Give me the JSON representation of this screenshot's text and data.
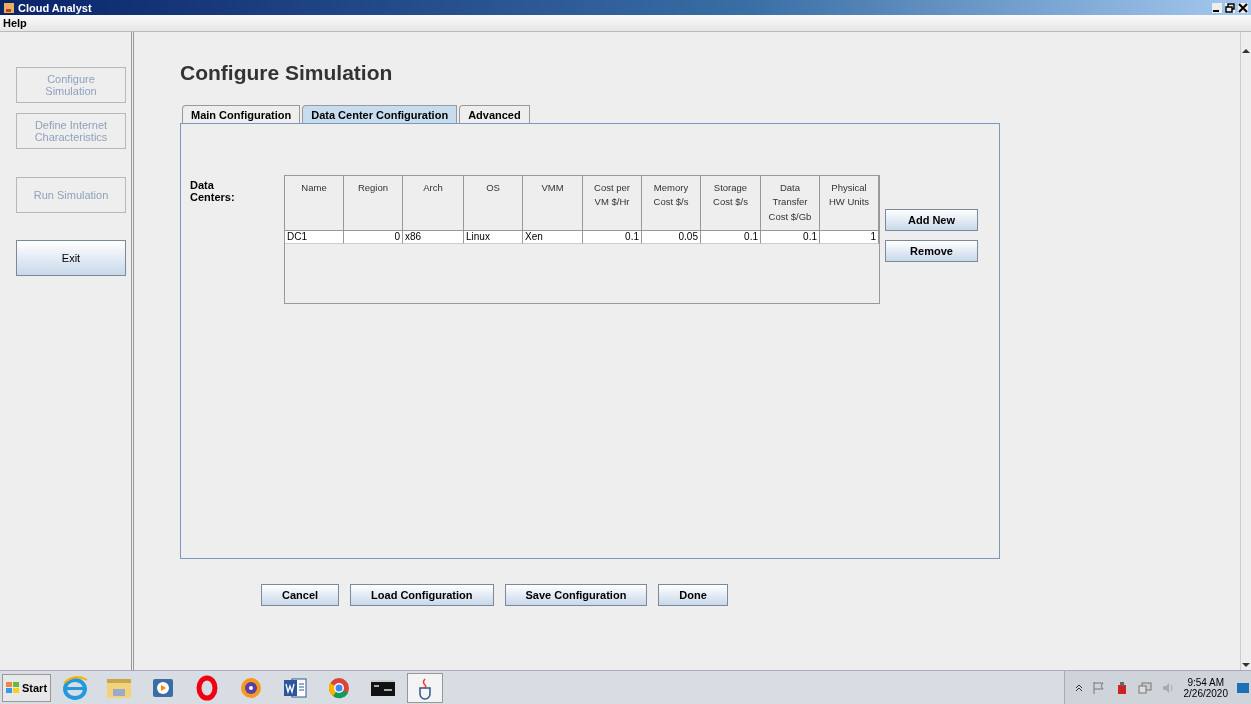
{
  "window": {
    "title": "Cloud Analyst"
  },
  "menu": [
    "Help"
  ],
  "sidebar": [
    {
      "label": "Configure Simulation",
      "disabled": true
    },
    {
      "label": "Define Internet Characteristics",
      "disabled": true
    },
    {
      "label": "Run Simulation",
      "disabled": true
    },
    {
      "label": "Exit",
      "disabled": false
    }
  ],
  "heading": "Configure Simulation",
  "tabs": [
    {
      "label": "Main Configuration",
      "selected": false
    },
    {
      "label": "Data Center Configuration",
      "selected": true
    },
    {
      "label": "Advanced",
      "selected": false
    }
  ],
  "data_centers": {
    "label": "Data Centers:",
    "columns": [
      {
        "label": "Name",
        "numeric": false
      },
      {
        "label": "Region",
        "numeric": true
      },
      {
        "label": "Arch",
        "numeric": false
      },
      {
        "label": "OS",
        "numeric": false
      },
      {
        "label": "VMM",
        "numeric": false
      },
      {
        "label": "Cost per VM $/Hr",
        "numeric": true
      },
      {
        "label": "Memory Cost $/s",
        "numeric": true
      },
      {
        "label": "Storage Cost $/s",
        "numeric": true
      },
      {
        "label": "Data Transfer Cost $/Gb",
        "numeric": true
      },
      {
        "label": "Physical HW Units",
        "numeric": true
      }
    ],
    "rows": [
      [
        "DC1",
        "0",
        "x86",
        "Linux",
        "Xen",
        "0.1",
        "0.05",
        "0.1",
        "0.1",
        "1"
      ]
    ],
    "buttons": [
      "Add New",
      "Remove"
    ]
  },
  "footer_buttons": [
    "Cancel",
    "Load Configuration",
    "Save Configuration",
    "Done"
  ],
  "taskbar": {
    "start": "Start",
    "apps": [
      {
        "kind": "ie"
      },
      {
        "kind": "folder"
      },
      {
        "kind": "media"
      },
      {
        "kind": "opera"
      },
      {
        "kind": "shield"
      },
      {
        "kind": "word"
      },
      {
        "kind": "chrome"
      },
      {
        "kind": "terminal"
      },
      {
        "kind": "java"
      }
    ],
    "time": "9:54 AM",
    "date": "2/26/2020"
  }
}
